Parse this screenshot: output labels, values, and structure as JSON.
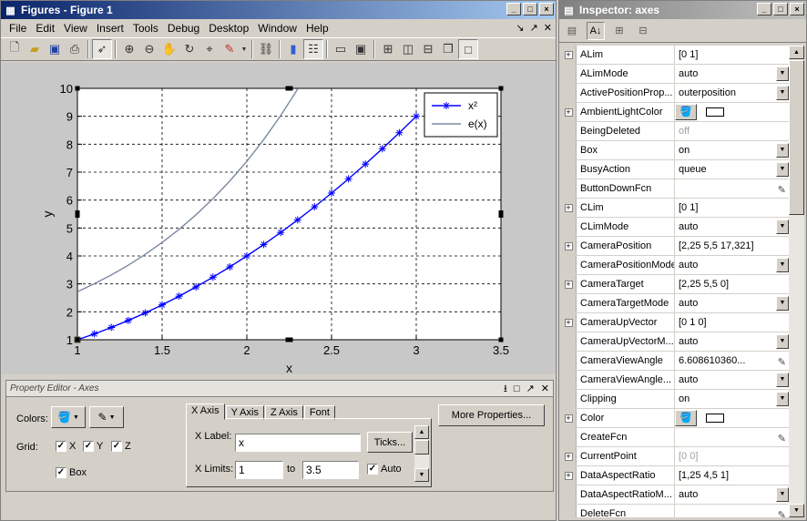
{
  "figure_window": {
    "title": "Figures - Figure 1",
    "menu": [
      "File",
      "Edit",
      "View",
      "Insert",
      "Tools",
      "Debug",
      "Desktop",
      "Window",
      "Help"
    ]
  },
  "chart_data": {
    "type": "line",
    "xlabel": "x",
    "ylabel": "y",
    "xlim": [
      1,
      3.5
    ],
    "ylim": [
      1,
      10
    ],
    "x_ticks": [
      "1",
      "1.5",
      "2",
      "2.5",
      "3",
      "3.5"
    ],
    "y_ticks": [
      "1",
      "2",
      "3",
      "4",
      "5",
      "6",
      "7",
      "8",
      "9",
      "10"
    ],
    "grid": true,
    "legend_position": "top-right",
    "series": [
      {
        "name": "x²",
        "color": "#0000ff",
        "marker": "*",
        "x": [
          1,
          1.1,
          1.2,
          1.3,
          1.4,
          1.5,
          1.6,
          1.7,
          1.8,
          1.9,
          2,
          2.1,
          2.2,
          2.3,
          2.4,
          2.5,
          2.6,
          2.7,
          2.8,
          2.9,
          3
        ],
        "y": [
          1,
          1.21,
          1.44,
          1.69,
          1.96,
          2.25,
          2.56,
          2.89,
          3.24,
          3.61,
          4,
          4.41,
          4.84,
          5.29,
          5.76,
          6.25,
          6.76,
          7.29,
          7.84,
          8.41,
          9
        ]
      },
      {
        "name": "e(x)",
        "color": "#7a8aa0",
        "marker": "",
        "x": [
          1,
          1.1,
          1.2,
          1.3,
          1.4,
          1.5,
          1.6,
          1.7,
          1.8,
          1.9,
          2,
          2.1,
          2.2,
          2.3
        ],
        "y": [
          2.718,
          3.004,
          3.32,
          3.669,
          4.055,
          4.482,
          4.953,
          5.474,
          6.05,
          6.686,
          7.389,
          8.166,
          9.025,
          9.974
        ]
      }
    ]
  },
  "property_editor": {
    "title": "Property Editor - Axes",
    "colors_label": "Colors:",
    "grid_label": "Grid:",
    "grid_x": "X",
    "grid_y": "Y",
    "grid_z": "Z",
    "box_label": "Box",
    "tabs": [
      "X Axis",
      "Y Axis",
      "Z Axis",
      "Font"
    ],
    "xlabel_label": "X Label:",
    "xlabel_value": "x",
    "ticks_button": "Ticks...",
    "xlimits_label": "X Limits:",
    "xlim_min": "1",
    "to_label": "to",
    "xlim_max": "3.5",
    "auto_label": "Auto",
    "more_properties_button": "More Properties..."
  },
  "inspector": {
    "title": "Inspector:  axes",
    "properties": [
      {
        "name": "ALim",
        "value": "[0 1]",
        "expandable": true,
        "control": "none"
      },
      {
        "name": "ALimMode",
        "value": "auto",
        "expandable": false,
        "control": "dropdown"
      },
      {
        "name": "ActivePositionProp...",
        "value": "outerposition",
        "expandable": false,
        "control": "dropdown"
      },
      {
        "name": "AmbientLightColor",
        "value": "",
        "expandable": true,
        "control": "color"
      },
      {
        "name": "BeingDeleted",
        "value": "off",
        "expandable": false,
        "control": "none",
        "grey": true
      },
      {
        "name": "Box",
        "value": "on",
        "expandable": false,
        "control": "dropdown"
      },
      {
        "name": "BusyAction",
        "value": "queue",
        "expandable": false,
        "control": "dropdown"
      },
      {
        "name": "ButtonDownFcn",
        "value": "",
        "expandable": false,
        "control": "edit"
      },
      {
        "name": "CLim",
        "value": "[0 1]",
        "expandable": true,
        "control": "none"
      },
      {
        "name": "CLimMode",
        "value": "auto",
        "expandable": false,
        "control": "dropdown"
      },
      {
        "name": "CameraPosition",
        "value": "[2,25 5,5 17,321]",
        "expandable": true,
        "control": "none"
      },
      {
        "name": "CameraPositionMode",
        "value": "auto",
        "expandable": false,
        "control": "dropdown"
      },
      {
        "name": "CameraTarget",
        "value": "[2,25 5,5 0]",
        "expandable": true,
        "control": "none"
      },
      {
        "name": "CameraTargetMode",
        "value": "auto",
        "expandable": false,
        "control": "dropdown"
      },
      {
        "name": "CameraUpVector",
        "value": "[0 1 0]",
        "expandable": true,
        "control": "none"
      },
      {
        "name": "CameraUpVectorM...",
        "value": "auto",
        "expandable": false,
        "control": "dropdown"
      },
      {
        "name": "CameraViewAngle",
        "value": "6.608610360...",
        "expandable": false,
        "control": "edit"
      },
      {
        "name": "CameraViewAngle...",
        "value": "auto",
        "expandable": false,
        "control": "dropdown"
      },
      {
        "name": "Clipping",
        "value": "on",
        "expandable": false,
        "control": "dropdown"
      },
      {
        "name": "Color",
        "value": "",
        "expandable": true,
        "control": "color"
      },
      {
        "name": "CreateFcn",
        "value": "",
        "expandable": false,
        "control": "edit"
      },
      {
        "name": "CurrentPoint",
        "value": "[0 0]",
        "expandable": true,
        "control": "none",
        "grey": true
      },
      {
        "name": "DataAspectRatio",
        "value": "[1,25 4,5 1]",
        "expandable": true,
        "control": "none"
      },
      {
        "name": "DataAspectRatioM...",
        "value": "auto",
        "expandable": false,
        "control": "dropdown"
      },
      {
        "name": "DeleteFcn",
        "value": "",
        "expandable": false,
        "control": "edit"
      }
    ]
  }
}
